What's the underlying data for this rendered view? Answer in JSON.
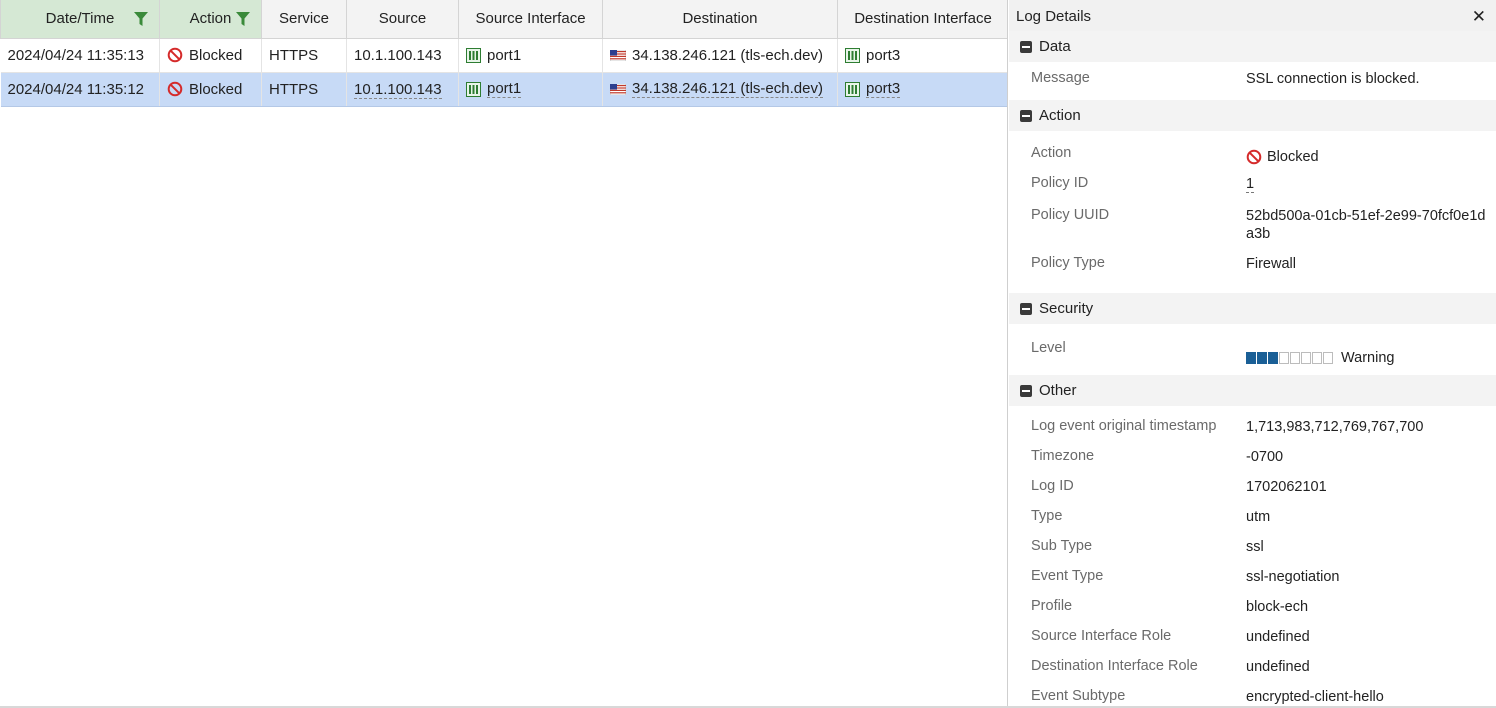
{
  "table": {
    "columns": [
      {
        "label": "Date/Time",
        "filtered": true
      },
      {
        "label": "Action",
        "filtered": true
      },
      {
        "label": "Service",
        "filtered": false
      },
      {
        "label": "Source",
        "filtered": false
      },
      {
        "label": "Source Interface",
        "filtered": false
      },
      {
        "label": "Destination",
        "filtered": false
      },
      {
        "label": "Destination Interface",
        "filtered": false
      }
    ],
    "rows": [
      {
        "datetime": "2024/04/24 11:35:13",
        "action": "Blocked",
        "service": "HTTPS",
        "source": "10.1.100.143",
        "source_interface": "port1",
        "destination": "34.138.246.121 (tls-ech.dev)",
        "destination_interface": "port3",
        "selected": false
      },
      {
        "datetime": "2024/04/24 11:35:12",
        "action": "Blocked",
        "service": "HTTPS",
        "source": "10.1.100.143",
        "source_interface": "port1",
        "destination": "34.138.246.121 (tls-ech.dev)",
        "destination_interface": "port3",
        "selected": true
      }
    ]
  },
  "details": {
    "title": "Log Details",
    "close_icon": "close-icon",
    "sections": {
      "data": {
        "title": "Data",
        "message_label": "Message",
        "message_value": "SSL connection is blocked."
      },
      "action": {
        "title": "Action",
        "action_label": "Action",
        "action_value": "Blocked",
        "policy_id_label": "Policy ID",
        "policy_id_value": "1",
        "policy_uuid_label": "Policy UUID",
        "policy_uuid_value": "52bd500a-01cb-51ef-2e99-70fcf0e1da3b",
        "policy_type_label": "Policy Type",
        "policy_type_value": "Firewall"
      },
      "security": {
        "title": "Security",
        "level_label": "Level",
        "level_value": "Warning",
        "level_filled": 3,
        "level_total": 8
      },
      "other": {
        "title": "Other",
        "fields": [
          {
            "label": "Log event original timestamp",
            "value": "1,713,983,712,769,767,700"
          },
          {
            "label": "Timezone",
            "value": "-0700"
          },
          {
            "label": "Log ID",
            "value": "1702062101"
          },
          {
            "label": "Type",
            "value": "utm"
          },
          {
            "label": "Sub Type",
            "value": "ssl"
          },
          {
            "label": "Event Type",
            "value": "ssl-negotiation"
          },
          {
            "label": "Profile",
            "value": "block-ech"
          },
          {
            "label": "Source Interface Role",
            "value": "undefined"
          },
          {
            "label": "Destination Interface Role",
            "value": "undefined"
          },
          {
            "label": "Event Subtype",
            "value": "encrypted-client-hello"
          }
        ]
      }
    }
  },
  "colors": {
    "selected_row": "#c7daf6",
    "filtered_header": "#d5e8d4",
    "filter_icon": "#3a8a3a",
    "blocked_icon": "#d52b2b",
    "port_icon": "#2e7d32",
    "level_on": "#1a5f96"
  }
}
